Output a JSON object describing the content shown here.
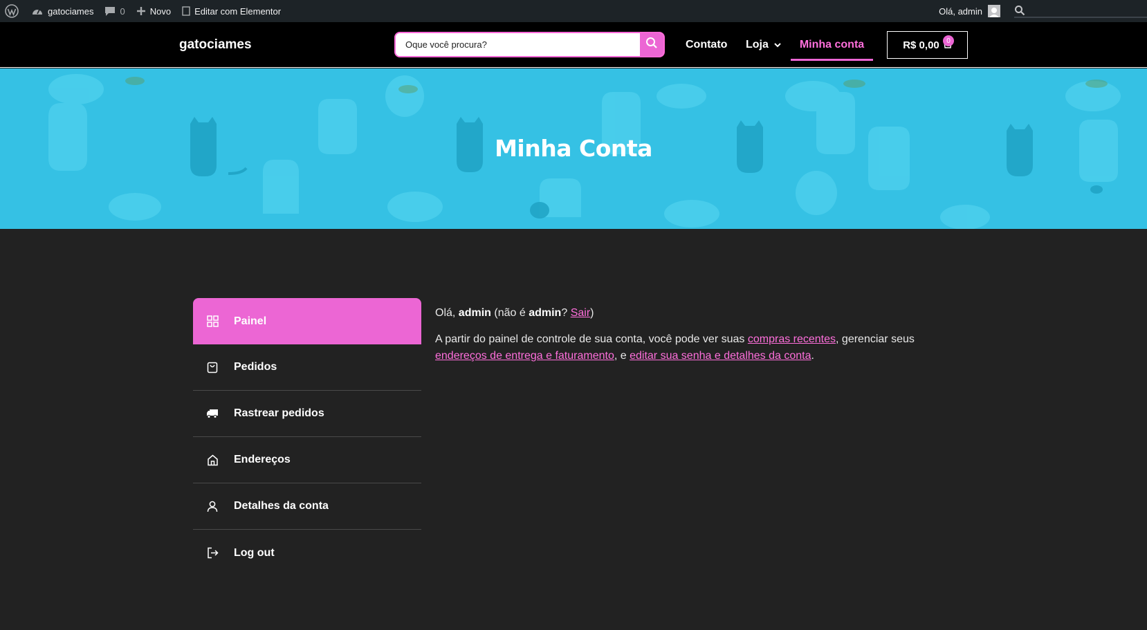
{
  "adminbar": {
    "site_name": "gatociames",
    "comments_count": "0",
    "new_label": "Novo",
    "elementor_label": "Editar com Elementor",
    "howdy": "Olá, admin"
  },
  "header": {
    "site_title": "gatociames",
    "search_placeholder": "Oque você procura?",
    "nav": {
      "contato": "Contato",
      "loja": "Loja",
      "minha_conta": "Minha conta"
    },
    "cart": {
      "total": "R$ 0,00",
      "count": "0"
    }
  },
  "hero": {
    "title": "Minha Conta"
  },
  "account_nav": {
    "items": [
      {
        "label": "Painel",
        "icon": "grid-icon"
      },
      {
        "label": "Pedidos",
        "icon": "bag-icon"
      },
      {
        "label": "Rastrear pedidos",
        "icon": "truck-icon"
      },
      {
        "label": "Endereços",
        "icon": "home-icon"
      },
      {
        "label": "Detalhes da conta",
        "icon": "user-icon"
      },
      {
        "label": "Log out",
        "icon": "logout-icon"
      }
    ]
  },
  "content": {
    "greeting_prefix": "Olá,",
    "username": "admin",
    "not_prefix": "(não é",
    "username2": "admin",
    "question": "?",
    "logout_link": "Sair",
    "close_paren": ")",
    "dashboard_intro": "A partir do painel de controle de sua conta, você pode ver suas",
    "link_orders": "compras recentes",
    "mid_text": ", gerenciar seus",
    "link_addresses": "endereços de entrega e faturamento",
    "and_text": ", e",
    "link_account": "editar sua senha e detalhes da conta",
    "end_dot": "."
  },
  "colors": {
    "accent": "#ec66d4",
    "hero_bg": "#35c1e4",
    "page_bg": "#222222",
    "header_bg": "#000000"
  }
}
